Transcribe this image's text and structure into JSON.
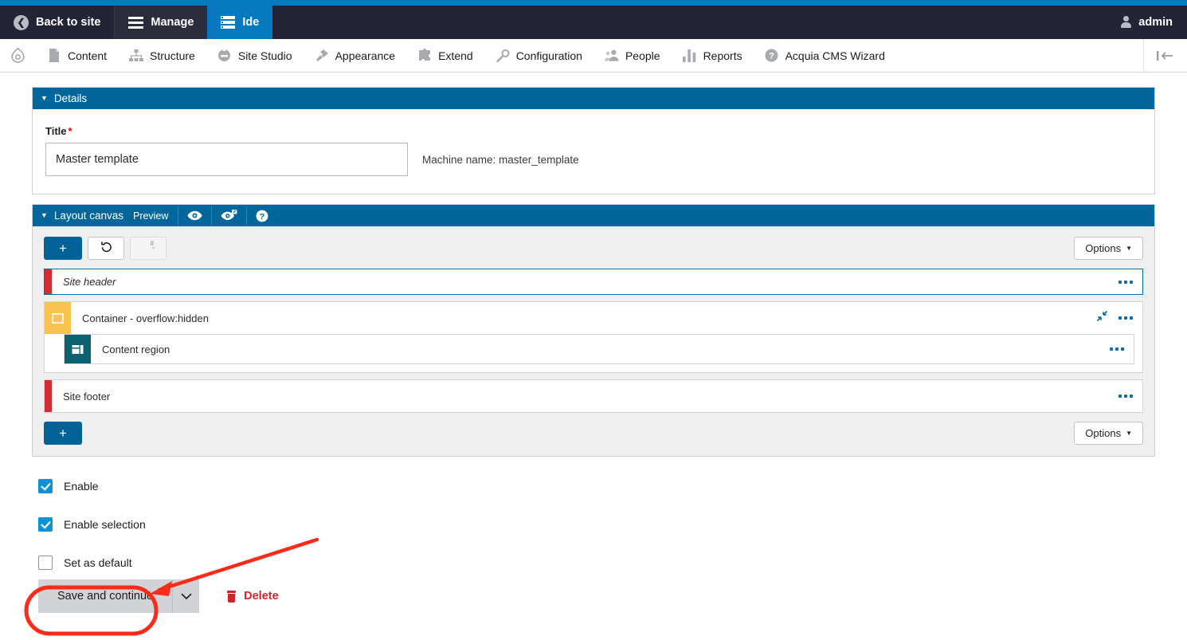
{
  "admin_toolbar": {
    "items": [
      {
        "label": "Back to site",
        "icon": "chevron-left-circle-icon",
        "state": "normal"
      },
      {
        "label": "Manage",
        "icon": "hamburger-icon",
        "state": "shaded"
      },
      {
        "label": "Ide",
        "icon": "ide-list-icon",
        "state": "active"
      }
    ],
    "user": {
      "label": "admin",
      "icon": "user-icon"
    },
    "accent_color": "#0678BE",
    "bar_color": "#232436"
  },
  "menu_bar": {
    "home_icon": "drupal-drop-icon",
    "items": [
      {
        "label": "Content",
        "icon": "document-icon"
      },
      {
        "label": "Structure",
        "icon": "sitemap-icon"
      },
      {
        "label": "Site Studio",
        "icon": "site-studio-icon"
      },
      {
        "label": "Appearance",
        "icon": "paintbrush-icon"
      },
      {
        "label": "Extend",
        "icon": "puzzle-piece-icon"
      },
      {
        "label": "Configuration",
        "icon": "wrench-icon"
      },
      {
        "label": "People",
        "icon": "people-icon"
      },
      {
        "label": "Reports",
        "icon": "bar-chart-icon"
      },
      {
        "label": "Acquia CMS Wizard",
        "icon": "question-circle-icon"
      }
    ],
    "collapse_icon": "collapse-sidebar-icon"
  },
  "details_panel": {
    "title": "Details",
    "caret": "▼",
    "title_field": {
      "label": "Title",
      "required_marker": "*",
      "value": "Master template",
      "placeholder": ""
    },
    "machine_name": "Machine name: master_template"
  },
  "layout_canvas": {
    "title": "Layout canvas",
    "caret": "▼",
    "header_actions": [
      {
        "label": "Preview",
        "type": "text",
        "icon": ""
      },
      {
        "label": "",
        "type": "icon",
        "icon": "eye-icon"
      },
      {
        "label": "",
        "type": "icon",
        "icon": "eye-external-link-icon"
      },
      {
        "label": "",
        "type": "icon",
        "icon": "question-circle-icon"
      }
    ],
    "toolbar": {
      "add_label": "+",
      "undo_icon": "undo-arrow-icon",
      "redo_icon": "redo-arrow-icon",
      "options_label": "Options",
      "options_caret": "▼"
    },
    "rows": [
      {
        "label": "Site header",
        "style": "italic",
        "marker": "red-bar",
        "marker_color": "#d32a36",
        "selected": true,
        "menu_icon": "ellipsis-icon"
      },
      {
        "label": "Container - overflow:hidden",
        "style": "normal",
        "marker": "amber-box",
        "marker_color": "#F9C44D",
        "icon": "square-outline-icon",
        "collapse_icon": "collapse-diagonal-icon",
        "menu_icon": "ellipsis-icon",
        "children": [
          {
            "label": "Content region",
            "style": "normal",
            "marker": "teal-box",
            "marker_color": "#0E6170",
            "icon": "layout-columns-icon",
            "menu_icon": "ellipsis-icon"
          }
        ]
      },
      {
        "label": "Site footer",
        "style": "normal",
        "marker": "red-bar",
        "marker_color": "#d32a36",
        "selected": false,
        "menu_icon": "ellipsis-icon"
      }
    ],
    "footer_toolbar": {
      "add_label": "+",
      "options_label": "Options",
      "options_caret": "▼"
    }
  },
  "checkboxes": [
    {
      "label": "Enable",
      "checked": true
    },
    {
      "label": "Enable selection",
      "checked": true
    },
    {
      "label": "Set as default",
      "checked": false
    }
  ],
  "actions": {
    "save_label": "Save and continue",
    "save_caret_icon": "chevron-down-icon",
    "delete_label": "Delete",
    "delete_icon": "trash-icon",
    "delete_color": "#d2232a"
  },
  "annotation": {
    "color": "#FF2A18",
    "highlight_target": "Save and continue",
    "shape": "rounded-rectangle-with-arrow"
  }
}
